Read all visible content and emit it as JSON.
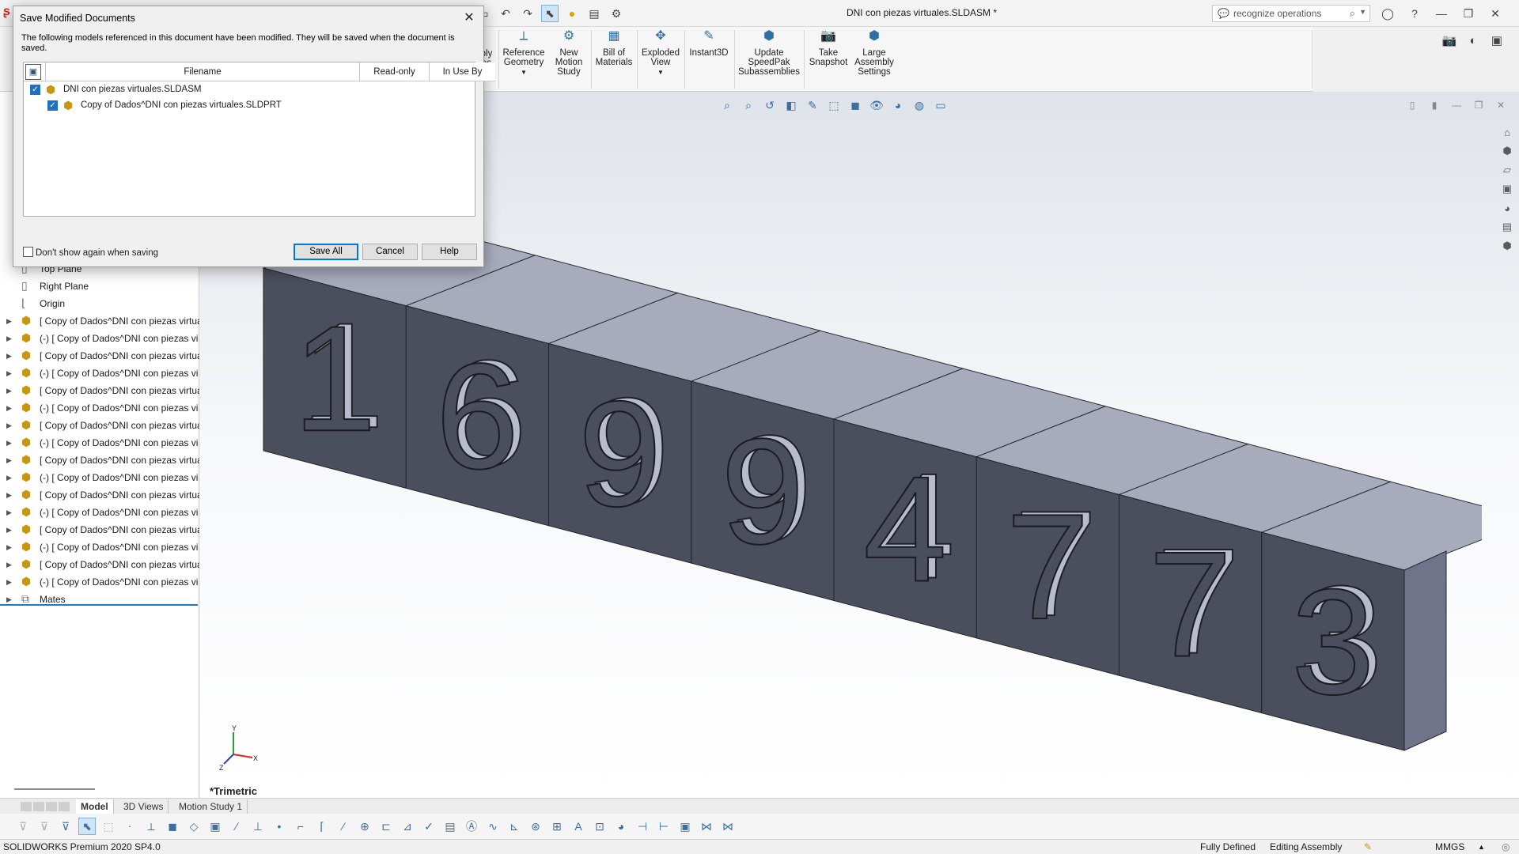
{
  "title_bar": {
    "document_title": "DNI con piezas virtuales.SLDASM *",
    "search_placeholder": "recognize operations"
  },
  "ribbon": {
    "partial_label_1": "bly",
    "partial_label_2": "es",
    "buttons": [
      {
        "line1": "Reference",
        "line2": "Geometry",
        "line3": ""
      },
      {
        "line1": "New",
        "line2": "Motion",
        "line3": "Study"
      },
      {
        "line1": "Bill of",
        "line2": "Materials",
        "line3": ""
      },
      {
        "line1": "Exploded",
        "line2": "View",
        "line3": ""
      },
      {
        "line1": "Instant3D",
        "line2": "",
        "line3": ""
      },
      {
        "line1": "Update",
        "line2": "SpeedPak",
        "line3": "Subassemblies"
      },
      {
        "line1": "Take",
        "line2": "Snapshot",
        "line3": ""
      },
      {
        "line1": "Large",
        "line2": "Assembly",
        "line3": "Settings"
      }
    ]
  },
  "feature_tree": {
    "items": [
      {
        "label": "Top Plane",
        "type": "plane"
      },
      {
        "label": "Right Plane",
        "type": "plane"
      },
      {
        "label": "Origin",
        "type": "origin"
      },
      {
        "label": "[ Copy of Dados^DNI con piezas virtua",
        "type": "part"
      },
      {
        "label": "(-) [ Copy of Dados^DNI con piezas vi",
        "type": "part"
      },
      {
        "label": "[ Copy of Dados^DNI con piezas virtua",
        "type": "part"
      },
      {
        "label": "(-) [ Copy of Dados^DNI con piezas vi",
        "type": "part"
      },
      {
        "label": "[ Copy of Dados^DNI con piezas virtua",
        "type": "part"
      },
      {
        "label": "(-) [ Copy of Dados^DNI con piezas vi",
        "type": "part"
      },
      {
        "label": "[ Copy of Dados^DNI con piezas virtua",
        "type": "part"
      },
      {
        "label": "(-) [ Copy of Dados^DNI con piezas vi",
        "type": "part"
      },
      {
        "label": "[ Copy of Dados^DNI con piezas virtua",
        "type": "part"
      },
      {
        "label": "(-) [ Copy of Dados^DNI con piezas vi",
        "type": "part"
      },
      {
        "label": "[ Copy of Dados^DNI con piezas virtua",
        "type": "part"
      },
      {
        "label": "(-) [ Copy of Dados^DNI con piezas vi",
        "type": "part"
      },
      {
        "label": "[ Copy of Dados^DNI con piezas virtua",
        "type": "part"
      },
      {
        "label": "(-) [ Copy of Dados^DNI con piezas vi",
        "type": "part"
      },
      {
        "label": "[ Copy of Dados^DNI con piezas virtua",
        "type": "part"
      },
      {
        "label": "(-) [ Copy of Dados^DNI con piezas vi",
        "type": "part"
      },
      {
        "label": "Mates",
        "type": "mates"
      }
    ]
  },
  "model": {
    "digits": [
      "1",
      "6",
      "9",
      "9",
      "4",
      "7",
      "7",
      "3"
    ],
    "body_color": "#4b4e5c",
    "top_color": "#a7abbb",
    "side_color": "#70748a"
  },
  "graphics": {
    "view_label": "*Trimetric",
    "triad_x": "X",
    "triad_y": "Y",
    "triad_z": "Z"
  },
  "bottom_tabs": [
    {
      "label": "Model",
      "active": true
    },
    {
      "label": "3D Views",
      "active": false
    },
    {
      "label": "Motion Study 1",
      "active": false
    }
  ],
  "status_bar": {
    "product": "SOLIDWORKS Premium 2020 SP4.0",
    "definition": "Fully Defined",
    "mode": "Editing Assembly",
    "units": "MMGS"
  },
  "dialog": {
    "title": "Save Modified Documents",
    "message": "The following models referenced in this document have been modified. They will be saved when the document is saved.",
    "columns": [
      "Filename",
      "Read-only",
      "In Use By"
    ],
    "files": [
      {
        "name": "DNI con piezas virtuales.SLDASM",
        "checked": true,
        "level": 0
      },
      {
        "name": "Copy of Dados^DNI con piezas virtuales.SLDPRT",
        "checked": true,
        "level": 1
      }
    ],
    "dont_show_label": "Don't show again when saving",
    "save_all_label": "Save All",
    "cancel_label": "Cancel",
    "help_label": "Help"
  },
  "colors": {
    "accent": "#1f6fc5",
    "tree_underline": "#1d78d0",
    "app_logo": "#d52b1e"
  }
}
